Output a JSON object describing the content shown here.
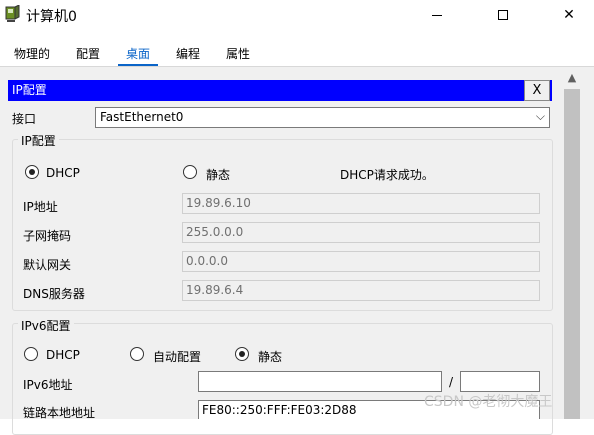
{
  "window": {
    "title": "计算机0"
  },
  "tabs": [
    {
      "label": "物理的"
    },
    {
      "label": "配置"
    },
    {
      "label": "桌面"
    },
    {
      "label": "编程"
    },
    {
      "label": "属性"
    }
  ],
  "ip_config": {
    "header": "IP配置",
    "close_label": "X",
    "interface_label": "接口",
    "interface_value": "FastEthernet0",
    "ipv4": {
      "group_title": "IP配置",
      "dhcp_label": "DHCP",
      "static_label": "静态",
      "status": "DHCP请求成功。",
      "fields": [
        {
          "label": "IP地址",
          "value": "19.89.6.10"
        },
        {
          "label": "子网掩码",
          "value": "255.0.0.0"
        },
        {
          "label": "默认网关",
          "value": "0.0.0.0"
        },
        {
          "label": "DNS服务器",
          "value": "19.89.6.4"
        }
      ]
    },
    "ipv6": {
      "group_title": "IPv6配置",
      "dhcp_label": "DHCP",
      "auto_label": "自动配置",
      "static_label": "静态",
      "address_label": "IPv6地址",
      "address_value": "",
      "prefix_separator": "/",
      "prefix_value": "",
      "link_local_label": "链路本地地址",
      "link_local_value": "FE80::250:FFF:FE03:2D88"
    }
  },
  "watermark": "CSDN @老彻大魔王"
}
